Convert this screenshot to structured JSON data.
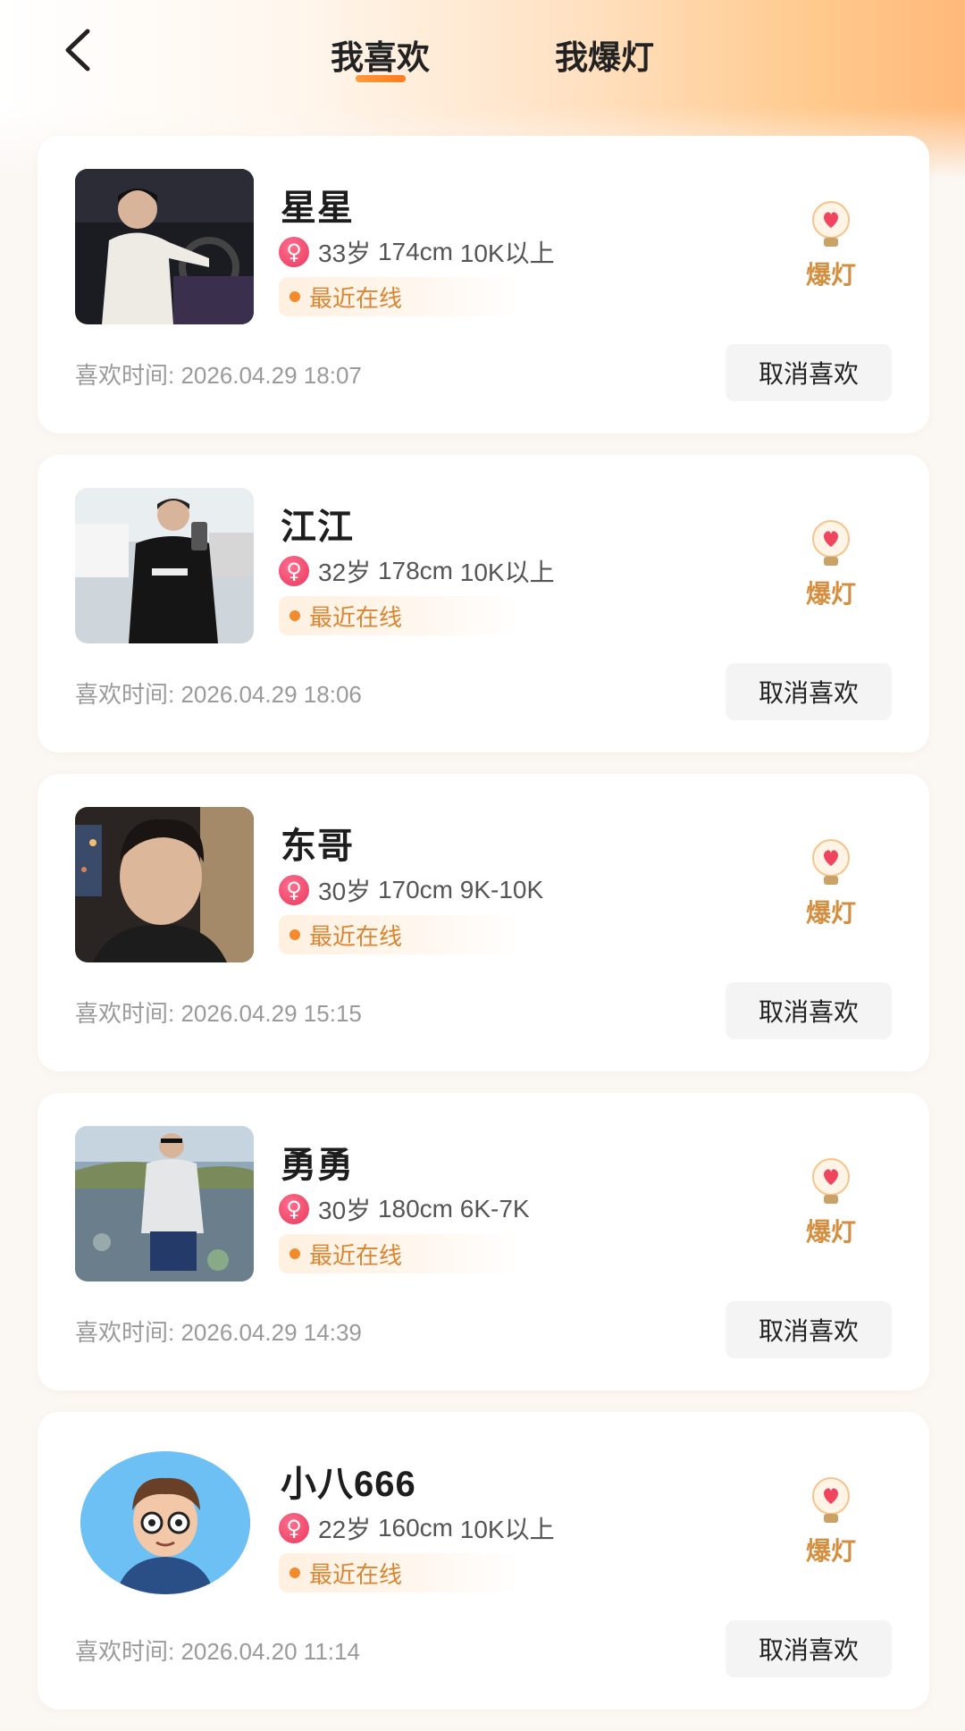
{
  "header": {
    "tabs": [
      {
        "label": "我喜欢",
        "active": true
      },
      {
        "label": "我爆灯",
        "active": false
      }
    ]
  },
  "colors": {
    "accent": "#ff8a2e",
    "status_orange": "#d98531",
    "bulb_label": "#d38f3f",
    "gender_pink": "#e8385e"
  },
  "icons": {
    "back": "chevron-left-icon",
    "gender": "female-icon",
    "bulb": "light-bulb-heart-icon"
  },
  "cards": [
    {
      "name": "星星",
      "age": "33岁",
      "height": "174cm",
      "income": "10K以上",
      "status": "最近在线",
      "like_time": "喜欢时间: 2026.04.29 18:07",
      "bulb_label": "爆灯",
      "unlike_label": "取消喜欢"
    },
    {
      "name": "江江",
      "age": "32岁",
      "height": "178cm",
      "income": "10K以上",
      "status": "最近在线",
      "like_time": "喜欢时间: 2026.04.29 18:06",
      "bulb_label": "爆灯",
      "unlike_label": "取消喜欢"
    },
    {
      "name": "东哥",
      "age": "30岁",
      "height": "170cm",
      "income": "9K-10K",
      "status": "最近在线",
      "like_time": "喜欢时间: 2026.04.29 15:15",
      "bulb_label": "爆灯",
      "unlike_label": "取消喜欢"
    },
    {
      "name": "勇勇",
      "age": "30岁",
      "height": "180cm",
      "income": "6K-7K",
      "status": "最近在线",
      "like_time": "喜欢时间: 2026.04.29 14:39",
      "bulb_label": "爆灯",
      "unlike_label": "取消喜欢"
    },
    {
      "name": "小八666",
      "age": "22岁",
      "height": "160cm",
      "income": "10K以上",
      "status": "最近在线",
      "like_time": "喜欢时间: 2026.04.20 11:14",
      "bulb_label": "爆灯",
      "unlike_label": "取消喜欢"
    }
  ]
}
